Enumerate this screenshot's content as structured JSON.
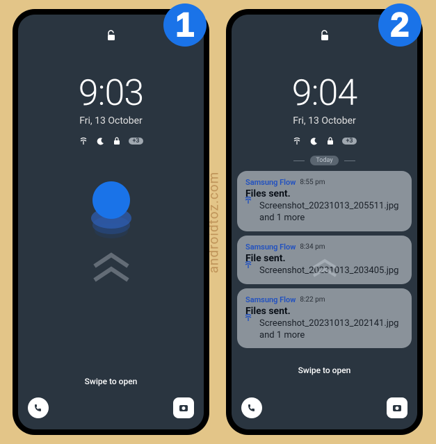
{
  "watermark": "androidtoz.com",
  "badges": {
    "one": "1",
    "two": "2"
  },
  "phone1": {
    "time": "9:03",
    "date": "Fri, 13 October",
    "count_badge": "+3",
    "swipe_text": "Swipe to open"
  },
  "phone2": {
    "time": "9:04",
    "date": "Fri, 13 October",
    "count_badge": "+3",
    "swipe_text": "Swipe to open",
    "today_label": "Today",
    "notifications": [
      {
        "app": "Samsung Flow",
        "time": "8:55 pm",
        "title": "Files sent.",
        "body": "Screenshot_20231013_205511.jpg and 1 more"
      },
      {
        "app": "Samsung Flow",
        "time": "8:34 pm",
        "title": "File sent.",
        "body": "Screenshot_20231013_203405.jpg"
      },
      {
        "app": "Samsung Flow",
        "time": "8:22 pm",
        "title": "Files sent.",
        "body": "Screenshot_20231013_202141.jpg and 1 more"
      }
    ]
  }
}
